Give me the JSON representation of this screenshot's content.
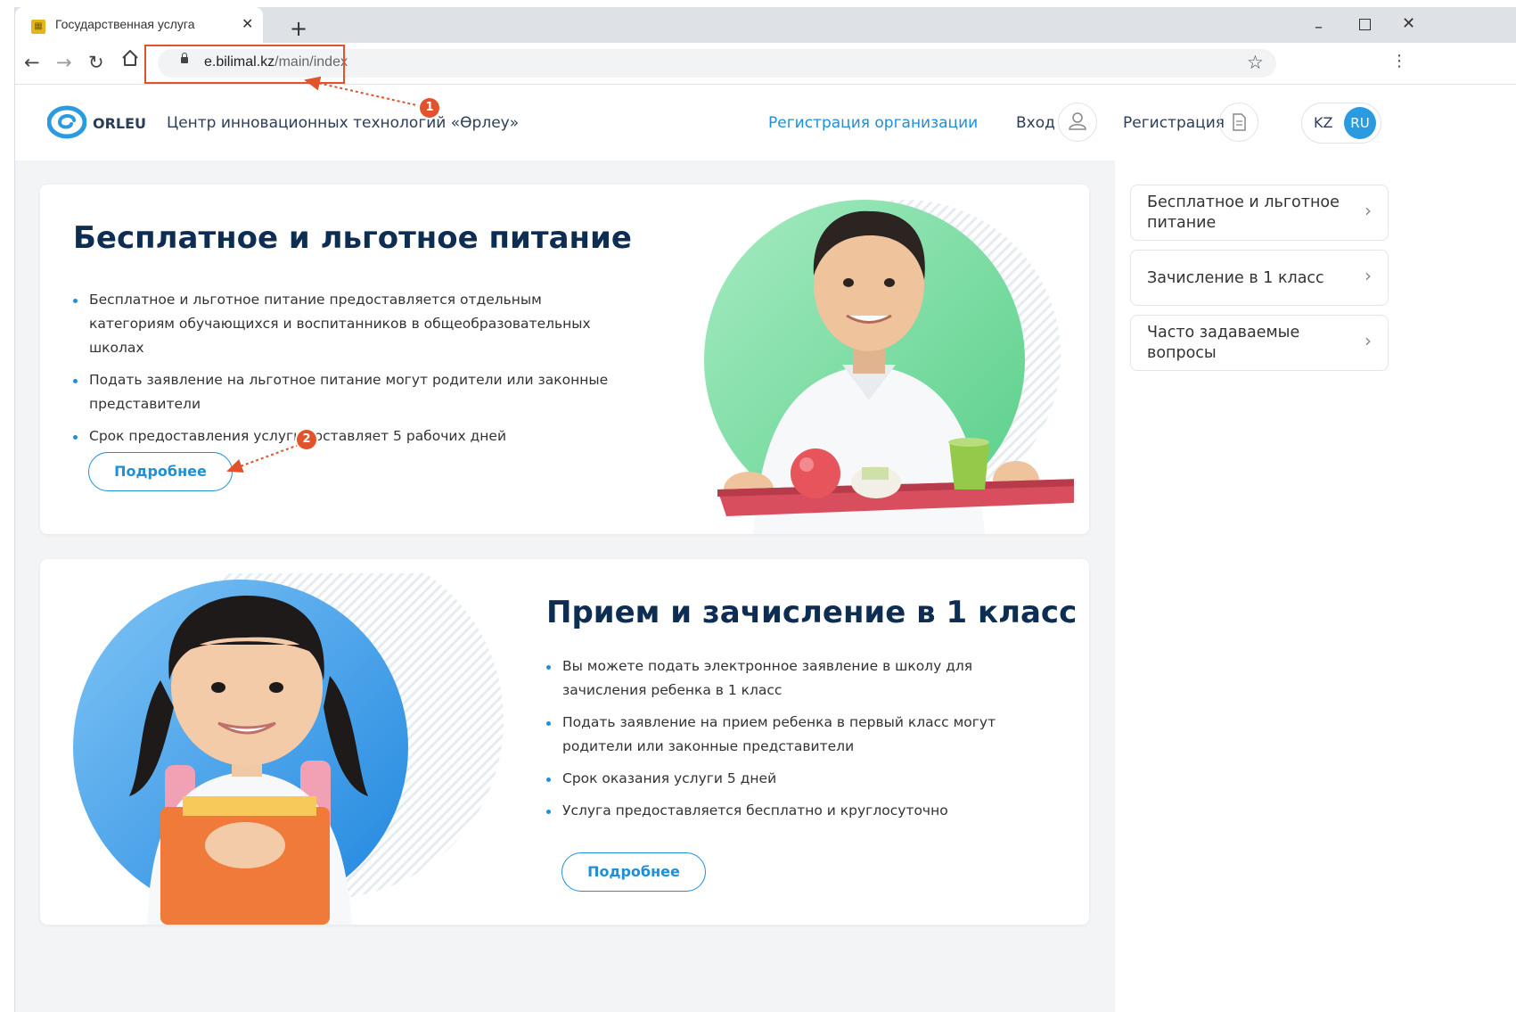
{
  "browser": {
    "tab_title": "Государственная услуга",
    "tab_close": "✕",
    "new_tab": "+",
    "url_host": "e.bilimal.kz",
    "url_path": "/main/index",
    "win_min": "–",
    "win_close": "✕",
    "menu": "⋮",
    "star": "☆"
  },
  "callouts": [
    "1",
    "2"
  ],
  "header": {
    "logo_text": "ORLEU",
    "org_name": "Центр инновационных технологий «Өрлеу»",
    "register_org": "Регистрация организации",
    "login": "Вход",
    "register": "Регистрация",
    "lang_kz": "KZ",
    "lang_ru": "RU"
  },
  "cards": [
    {
      "title": "Бесплатное и льготное питание",
      "bullets": [
        "Бесплатное и льготное питание предоставляется отдельным категориям обучающихся и воспитанников в общеобразовательных школах",
        "Подать заявление на льготное питание могут родители или законные представители",
        "Срок предоставления услуги составляет 5 рабочих дней"
      ],
      "button": "Подробнее"
    },
    {
      "title": "Прием и зачисление в 1 класс",
      "bullets": [
        "Вы можете подать электронное заявление в школу для зачисления ребенка в 1 класс",
        "Подать заявление на прием ребенка в первый класс могут родители или законные представители",
        "Срок оказания услуги 5 дней",
        " Услуга предоставляется бесплатно и круглосуточно"
      ],
      "button": "Подробнее"
    }
  ],
  "sidebar": {
    "items": [
      {
        "label": "Бесплатное и льготное питание"
      },
      {
        "label": "Зачисление в 1 класс"
      },
      {
        "label": "Часто задаваемые вопросы"
      }
    ],
    "chevron": "›"
  },
  "colors": {
    "accent": "#1f8fd8",
    "title": "#0e2d52",
    "annotation": "#e2532b"
  }
}
